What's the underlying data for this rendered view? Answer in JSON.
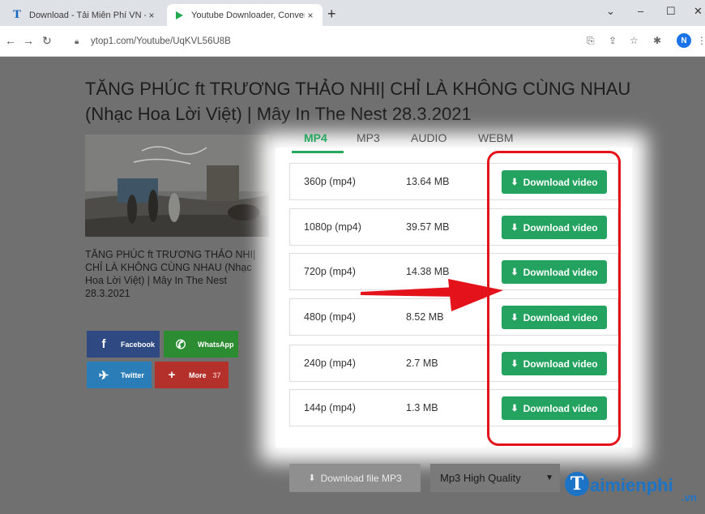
{
  "browser": {
    "tabs": [
      {
        "title": "Download - Tải Miễn Phí VN - Ph",
        "favicon": "T",
        "active": false
      },
      {
        "title": "Youtube Downloader, Convert Vi",
        "favicon": "play-icon",
        "active": true
      }
    ],
    "close_glyph": "×",
    "new_tab_glyph": "+",
    "url": "ytop1.com/Youtube/UqKVL56U8B",
    "profile_initial": "N"
  },
  "video": {
    "title": "TĂNG PHÚC ft TRƯƠNG THẢO NHI| CHỈ LÀ KHÔNG CÙNG NHAU (Nhạc Hoa Lời Việt) | Mây In The Nest 28.3.2021",
    "caption": "TĂNG PHÚC ft TRƯƠNG THẢO NHI| CHỈ LÀ KHÔNG CÙNG NHAU (Nhạc Hoa Lời Việt) | Mây In The Nest 28.3.2021"
  },
  "share": {
    "facebook": "Facebook",
    "whatsapp": "WhatsApp",
    "twitter": "Twitter",
    "more": "More",
    "more_count": "37"
  },
  "format_tabs": [
    "MP4",
    "MP3",
    "AUDIO",
    "WEBM"
  ],
  "active_tab": "MP4",
  "download_label": "Download video",
  "rows": [
    {
      "quality": "360p (mp4)",
      "size": "13.64 MB"
    },
    {
      "quality": "1080p (mp4)",
      "size": "39.57 MB"
    },
    {
      "quality": "720p (mp4)",
      "size": "14.38 MB"
    },
    {
      "quality": "480p (mp4)",
      "size": "8.52 MB"
    },
    {
      "quality": "240p (mp4)",
      "size": "2.7 MB"
    },
    {
      "quality": "144p (mp4)",
      "size": "1.3 MB"
    }
  ],
  "mp3": {
    "button": "Download file MP3",
    "quality": "Mp3 High Quality"
  },
  "watermark": {
    "logo": "T",
    "text": "aimienphi",
    "suffix": ".vn"
  },
  "colors": {
    "accent": "#23a35f",
    "highlight": "#e3121b"
  }
}
